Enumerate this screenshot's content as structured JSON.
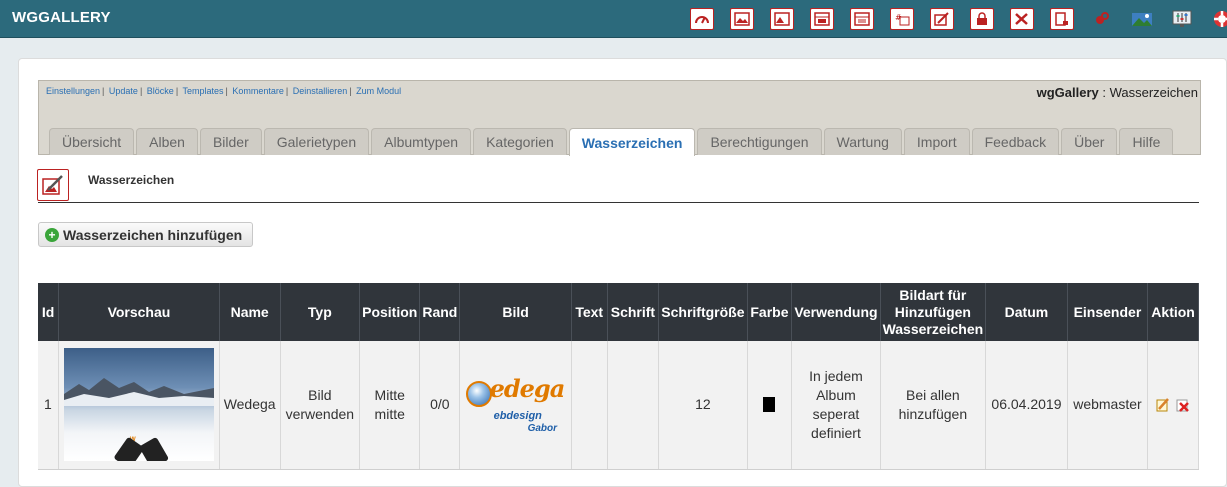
{
  "app": {
    "title": "WGGALLERY"
  },
  "toolbar": {
    "icons": [
      "dashboard-icon",
      "albums-icon",
      "images-icon",
      "gallery-types-icon",
      "album-types-icon",
      "categories-icon",
      "watermark-icon",
      "permissions-icon",
      "maintenance-icon",
      "import-icon",
      "feedback-icon",
      "about-icon",
      "preferences-icon",
      "help-icon"
    ]
  },
  "module": {
    "links": [
      "Einstellungen",
      "Update",
      "Blöcke",
      "Templates",
      "Kommentare",
      "Deinstallieren",
      "Zum Modul"
    ],
    "title_bold": "wgGallery",
    "title_rest": " : Wasserzeichen",
    "tabs": [
      "Übersicht",
      "Alben",
      "Bilder",
      "Galerietypen",
      "Albumtypen",
      "Kategorien",
      "Wasserzeichen",
      "Berechtigungen",
      "Wartung",
      "Import",
      "Feedback",
      "Über",
      "Hilfe"
    ],
    "active_tab": "Wasserzeichen"
  },
  "page": {
    "title": "Wasserzeichen",
    "add_button": "Wasserzeichen hinzufügen"
  },
  "table": {
    "headers": [
      "Id",
      "Vorschau",
      "Name",
      "Typ",
      "Position",
      "Rand",
      "Bild",
      "Text",
      "Schrift",
      "Schriftgröße",
      "Farbe",
      "Verwendung",
      "Bildart für Hinzufügen Wasserzeichen",
      "Datum",
      "Einsender",
      "Aktion"
    ],
    "rows": [
      {
        "id": "1",
        "name": "Wedega",
        "typ": "Bild verwenden",
        "position": "Mitte mitte",
        "rand": "0/0",
        "bild_logo": {
          "line1": "edega",
          "line2": "ebdesign",
          "line3": "Gabor"
        },
        "text": "",
        "schrift": "",
        "schriftgroesse": "12",
        "farbe": "#000000",
        "verwendung": "In jedem Album seperat definiert",
        "bildart": "Bei allen hinzufügen",
        "datum": "06.04.2019",
        "einsender": "webmaster",
        "actions": [
          "edit-icon",
          "delete-icon"
        ]
      }
    ]
  },
  "colors": {
    "topbar": "#2c6a7c",
    "accent_red": "#bb2222",
    "link": "#2a6fb3",
    "table_header": "#30353b"
  }
}
